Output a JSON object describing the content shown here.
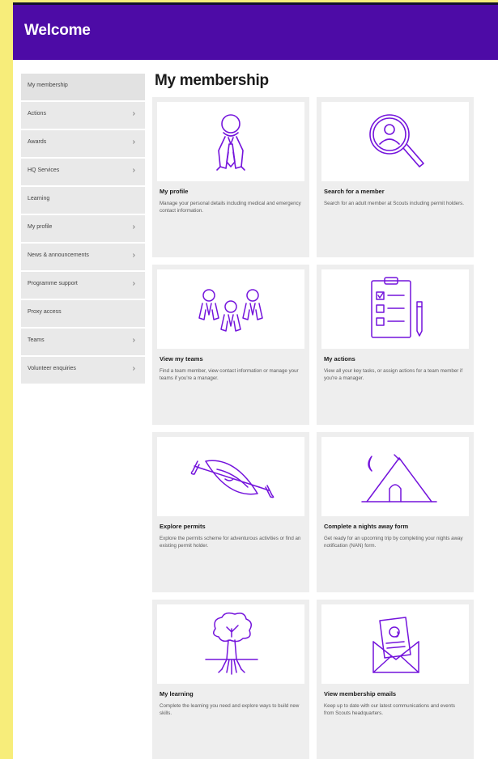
{
  "header": {
    "title": "Welcome"
  },
  "sidebar": {
    "items": [
      {
        "label": "My membership",
        "chevron": false
      },
      {
        "label": "Actions",
        "chevron": true
      },
      {
        "label": "Awards",
        "chevron": true
      },
      {
        "label": "HQ Services",
        "chevron": true
      },
      {
        "label": "Learning",
        "chevron": false
      },
      {
        "label": "My profile",
        "chevron": true
      },
      {
        "label": "News & announcements",
        "chevron": true
      },
      {
        "label": "Programme support",
        "chevron": true
      },
      {
        "label": "Proxy access",
        "chevron": false
      },
      {
        "label": "Teams",
        "chevron": true
      },
      {
        "label": "Volunteer enquiries",
        "chevron": true
      }
    ]
  },
  "main": {
    "heading": "My membership",
    "cards": [
      {
        "title": "My profile",
        "description": "Manage your personal details including medical and emergency contact information.",
        "icon": "person-icon"
      },
      {
        "title": "Search for a member",
        "description": "Search for an adult member at Scouts including permit holders.",
        "icon": "magnifier-person-icon"
      },
      {
        "title": "View my teams",
        "description": "Find a team member, view contact information or manage your teams if you're a manager.",
        "icon": "team-icon"
      },
      {
        "title": "My actions",
        "description": "View all your key tasks, or assign actions for a team member if you're a manager.",
        "icon": "clipboard-icon"
      },
      {
        "title": "Explore permits",
        "description": "Explore the permits scheme for adventurous activities or find an existing permit holder.",
        "icon": "kayak-icon"
      },
      {
        "title": "Complete a nights away form",
        "description": "Get ready for an upcoming trip by completing your nights away notification (NAN) form.",
        "icon": "tent-icon"
      },
      {
        "title": "My learning",
        "description": "Complete the learning you need and explore ways to build new skills.",
        "icon": "tree-icon"
      },
      {
        "title": "View membership emails",
        "description": "Keep up to date with our latest communications and events from Scouts headquarters.",
        "icon": "envelope-icon"
      }
    ]
  },
  "colors": {
    "brand": "#4d0ba6",
    "background": "#f7ed7a",
    "icon_stroke": "#7414dc"
  }
}
